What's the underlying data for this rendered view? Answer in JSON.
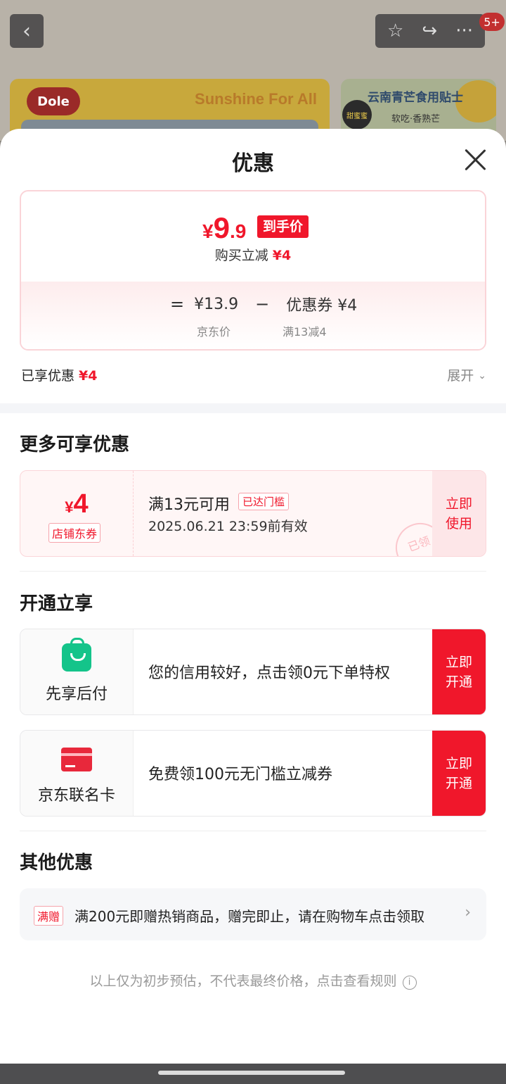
{
  "background": {
    "badge": "5+",
    "banner_left": {
      "brand": "Dole",
      "slogan": "Sunshine For All"
    },
    "banner_right": {
      "title": "云南青芒食用贴士",
      "subtitle": "软吃·香熟芒",
      "stamp": "甜蜜蜜"
    }
  },
  "sheet": {
    "title": "优惠",
    "price": {
      "currency": "¥",
      "final_int": "9",
      "final_dec": ".9",
      "final_tag": "到手价",
      "buy_reduce_label": "购买立减",
      "buy_reduce_value": "¥4",
      "equals": "=",
      "jd_price": "¥13.9",
      "minus": "−",
      "coupon_value": "优惠券 ¥4",
      "jd_price_label": "京东价",
      "coupon_cond": "满13减4"
    },
    "enjoyed": {
      "label": "已享优惠",
      "value": "¥4"
    },
    "expand_label": "展开",
    "more_section_title": "更多可享优惠",
    "coupon": {
      "currency": "¥",
      "amount": "4",
      "type": "店铺东券",
      "condition": "满13元可用",
      "reached_tag": "已达门槛",
      "valid_until": "2025.06.21 23:59前有效",
      "button_line1": "立即",
      "button_line2": "使用",
      "stamp": "已领"
    },
    "open_section_title": "开通立享",
    "open_items": [
      {
        "name": "先享后付",
        "desc": "您的信用较好，点击领0元下单特权",
        "btn1": "立即",
        "btn2": "开通",
        "icon": "shopping-bag-icon"
      },
      {
        "name": "京东联名卡",
        "desc": "免费领100元无门槛立减券",
        "btn1": "立即",
        "btn2": "开通",
        "icon": "credit-card-icon"
      }
    ],
    "other_section_title": "其他优惠",
    "promo": {
      "tag": "满赠",
      "text": "满200元即赠热销商品，赠完即止，请在购物车点击领取"
    },
    "disclaimer": "以上仅为初步预估，不代表最终价格，点击查看规则"
  },
  "colors": {
    "accent": "#f0172b",
    "green": "#14c48a"
  }
}
